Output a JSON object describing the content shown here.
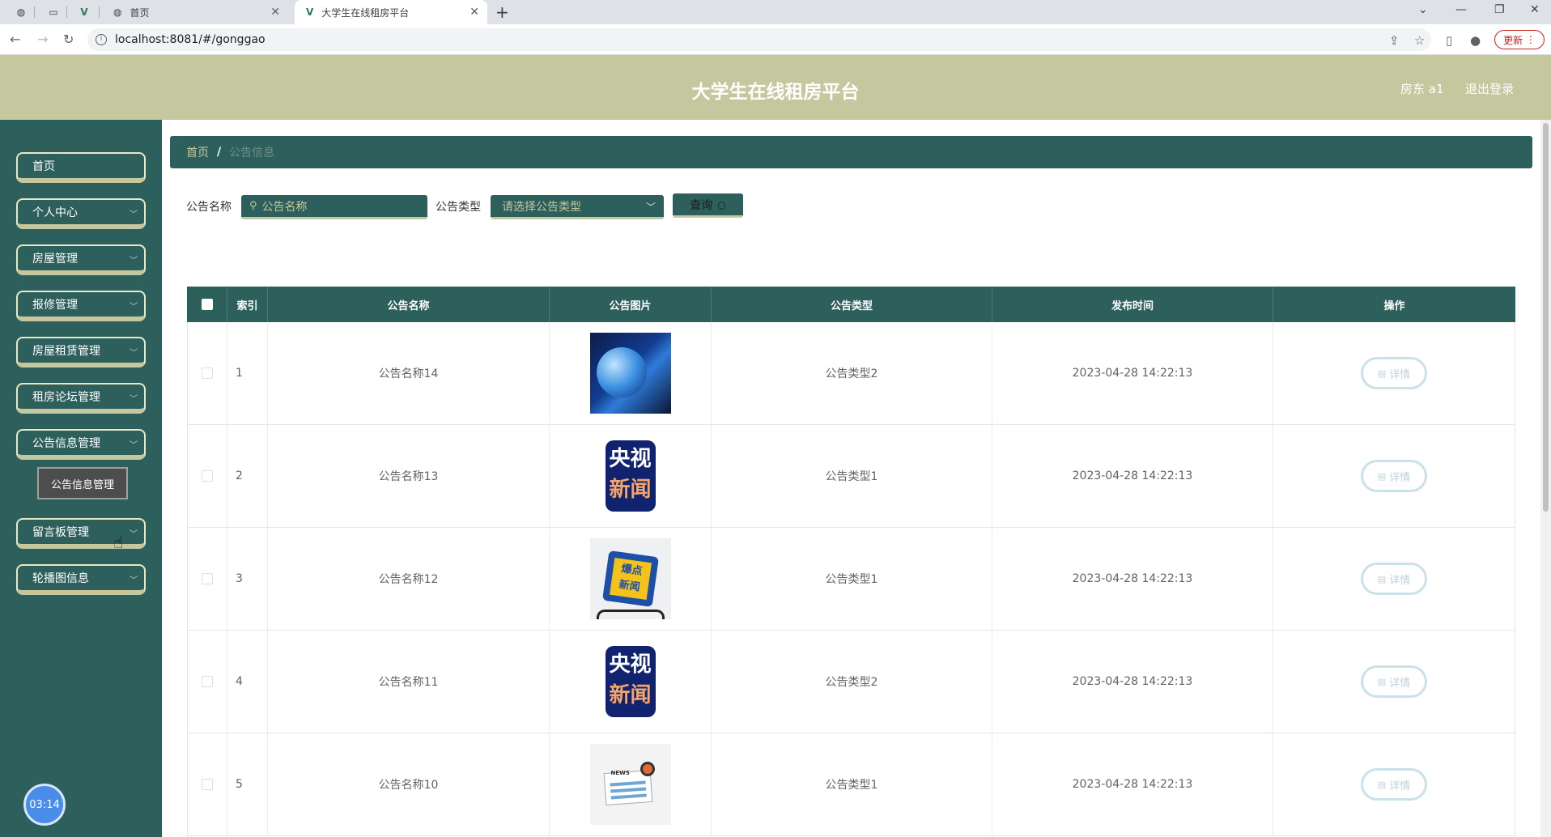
{
  "browser": {
    "tabs": [
      {
        "title": "首页",
        "active": false
      },
      {
        "title": "大学生在线租房平台",
        "active": true
      }
    ],
    "url": "localhost:8081/#/gonggao",
    "update_label": "更新"
  },
  "header": {
    "title": "大学生在线租房平台",
    "user": "房东 a1",
    "logout": "退出登录"
  },
  "sidebar": {
    "items": [
      {
        "label": "首页",
        "has_sub": false
      },
      {
        "label": "个人中心",
        "has_sub": true
      },
      {
        "label": "房屋管理",
        "has_sub": true
      },
      {
        "label": "报修管理",
        "has_sub": true
      },
      {
        "label": "房屋租赁管理",
        "has_sub": true
      },
      {
        "label": "租房论坛管理",
        "has_sub": true
      },
      {
        "label": "公告信息管理",
        "has_sub": true
      },
      {
        "label": "留言板管理",
        "has_sub": true
      },
      {
        "label": "轮播图信息",
        "has_sub": true
      }
    ],
    "submenu_label": "公告信息管理",
    "clock": "03:14"
  },
  "breadcrumb": {
    "home": "首页",
    "separator": "/",
    "current": "公告信息"
  },
  "search": {
    "name_label": "公告名称",
    "name_placeholder": "公告名称",
    "type_label": "公告类型",
    "type_placeholder": "请选择公告类型",
    "query_label": "查询"
  },
  "table": {
    "headers": [
      "",
      "索引",
      "公告名称",
      "公告图片",
      "公告类型",
      "发布时间",
      "操作"
    ],
    "rows": [
      {
        "index": "1",
        "name": "公告名称14",
        "image": "globe",
        "type": "公告类型2",
        "time": "2023-04-28 14:22:13",
        "action": "详情"
      },
      {
        "index": "2",
        "name": "公告名称13",
        "image": "cctv",
        "type": "公告类型1",
        "time": "2023-04-28 14:22:13",
        "action": "详情"
      },
      {
        "index": "3",
        "name": "公告名称12",
        "image": "hot",
        "type": "公告类型1",
        "time": "2023-04-28 14:22:13",
        "action": "详情"
      },
      {
        "index": "4",
        "name": "公告名称11",
        "image": "cctv",
        "type": "公告类型2",
        "time": "2023-04-28 14:22:13",
        "action": "详情"
      },
      {
        "index": "5",
        "name": "公告名称10",
        "image": "news",
        "type": "公告类型1",
        "time": "2023-04-28 14:22:13",
        "action": "详情"
      }
    ]
  },
  "colors": {
    "primary": "#2d5f5c",
    "accent": "#c5c79e"
  }
}
